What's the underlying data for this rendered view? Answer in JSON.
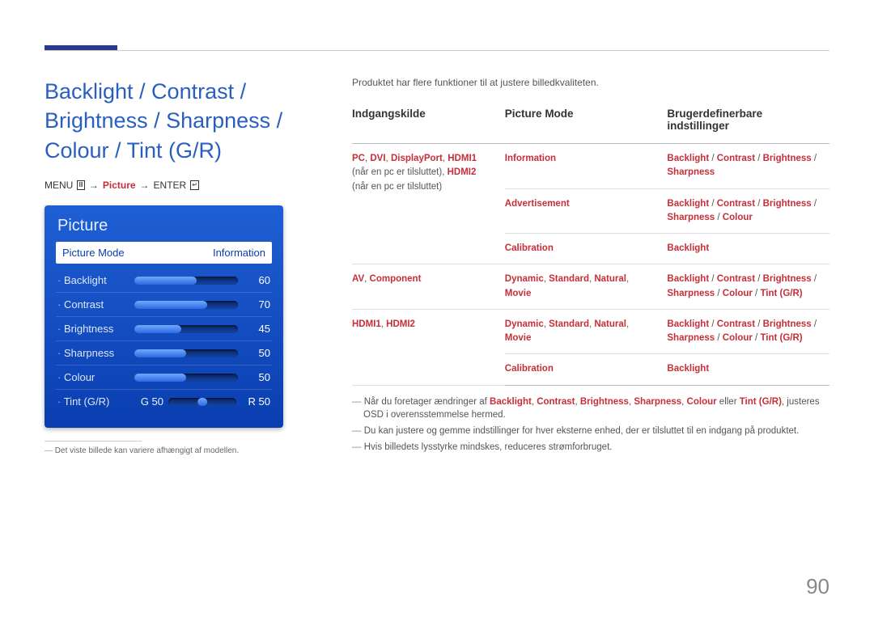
{
  "page_number": "90",
  "main_title": "Backlight / Contrast / Brightness / Sharpness / Colour / Tint (G/R)",
  "menu_path": {
    "menu": "MENU",
    "picture": "Picture",
    "enter": "ENTER"
  },
  "osd": {
    "title": "Picture",
    "selected_label": "Picture Mode",
    "selected_value": "Information",
    "rows": [
      {
        "label": "Backlight",
        "value": "60",
        "pct": 60
      },
      {
        "label": "Contrast",
        "value": "70",
        "pct": 70
      },
      {
        "label": "Brightness",
        "value": "45",
        "pct": 45
      },
      {
        "label": "Sharpness",
        "value": "50",
        "pct": 50
      },
      {
        "label": "Colour",
        "value": "50",
        "pct": 50
      }
    ],
    "tint": {
      "label": "Tint (G/R)",
      "left": "G 50",
      "right": "R 50"
    }
  },
  "left_footnote": "Det viste billede kan variere afhængigt af modellen.",
  "intro": "Produktet har flere funktioner til at justere billedkvaliteten.",
  "table": {
    "headers": [
      "Indgangskilde",
      "Picture Mode",
      "Brugerdefinerbare indstillinger"
    ],
    "rows": [
      {
        "col1_hl": [
          "PC",
          "DVI",
          "DisplayPort",
          "HDMI1"
        ],
        "col1_plain1": " (når en pc er tilsluttet), ",
        "col1_hl2": "HDMI2",
        "col1_plain2": " (når en pc er tilsluttet)",
        "col2": "Information",
        "col3": [
          "Backlight",
          "Contrast",
          "Brightness",
          "Sharpness"
        ]
      },
      {
        "col2": "Advertisement",
        "col3": [
          "Backlight",
          "Contrast",
          "Brightness",
          "Sharpness",
          "Colour"
        ]
      },
      {
        "col2": "Calibration",
        "col3": [
          "Backlight"
        ]
      },
      {
        "col1_hl": [
          "AV",
          "Component"
        ],
        "col2_hl": [
          "Dynamic",
          "Standard",
          "Natural",
          "Movie"
        ],
        "col3": [
          "Backlight",
          "Contrast",
          "Brightness",
          "Sharpness",
          "Colour",
          "Tint (G/R)"
        ]
      },
      {
        "col1_hl": [
          "HDMI1",
          "HDMI2"
        ],
        "col2_hl": [
          "Dynamic",
          "Standard",
          "Natural",
          "Movie"
        ],
        "col3": [
          "Backlight",
          "Contrast",
          "Brightness",
          "Sharpness",
          "Colour",
          "Tint (G/R)"
        ]
      },
      {
        "col2": "Calibration",
        "col3": [
          "Backlight"
        ]
      }
    ]
  },
  "notes": {
    "n1_pre": "Når du foretager ændringer af ",
    "n1_terms": [
      "Backlight",
      "Contrast",
      "Brightness",
      "Sharpness",
      "Colour"
    ],
    "n1_mid": "  eller ",
    "n1_last": "Tint (G/R)",
    "n1_post": ", justeres OSD i overensstemmelse hermed.",
    "n2": "Du kan justere og gemme indstillinger for hver eksterne enhed, der er tilsluttet til en indgang på produktet.",
    "n3": "Hvis billedets lysstyrke mindskes, reduceres strømforbruget."
  }
}
